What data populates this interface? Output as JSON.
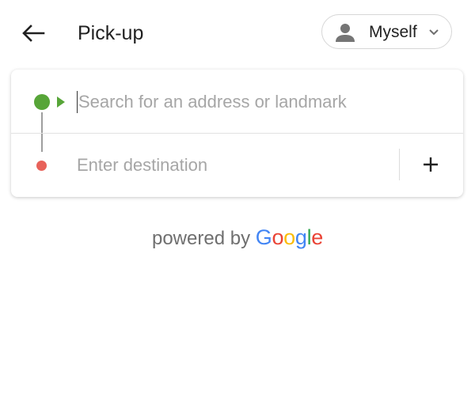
{
  "header": {
    "title": "Pick-up",
    "rider": "Myself"
  },
  "route": {
    "pickup_placeholder": "Search for an address or landmark",
    "pickup_value": "",
    "destination_placeholder": "Enter destination",
    "destination_value": ""
  },
  "attribution": {
    "prefix": "powered by",
    "brand_letters": [
      "G",
      "o",
      "o",
      "g",
      "l",
      "e"
    ],
    "brand_colors": [
      "#4285F4",
      "#EA4335",
      "#FBBC05",
      "#4285F4",
      "#34A853",
      "#EA4335"
    ]
  },
  "icons": {
    "back": "back-arrow-icon",
    "person": "person-icon",
    "chevron": "chevron-down-icon",
    "add": "plus-icon"
  },
  "colors": {
    "origin": "#57a538",
    "destination": "#e8625a",
    "placeholder": "#a6a6a6"
  }
}
